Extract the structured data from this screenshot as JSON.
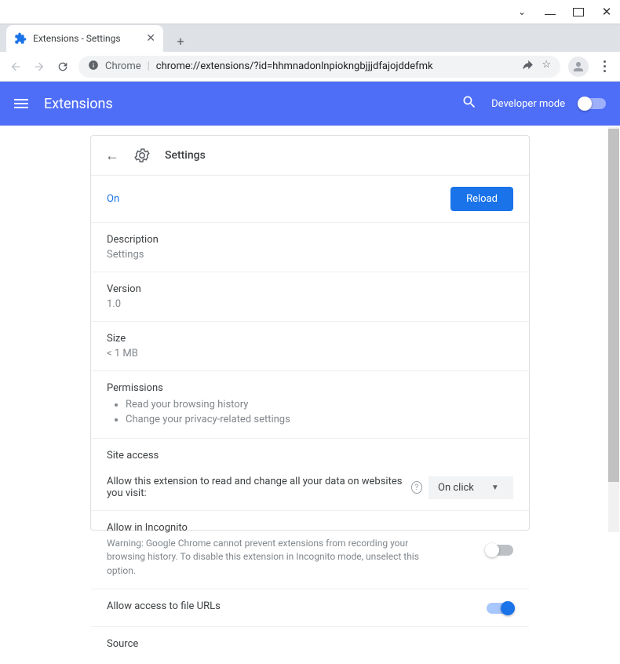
{
  "window": {
    "tab_title": "Extensions - Settings"
  },
  "addressbar": {
    "scheme_label": "Chrome",
    "url": "chrome://extensions/?id=hhmnadonlnpiokngbjjjdfajojddefmk"
  },
  "header": {
    "title": "Extensions",
    "dev_mode_label": "Developer mode",
    "dev_mode_on": false
  },
  "detail": {
    "title": "Settings",
    "on_label": "On",
    "reload_label": "Reload",
    "description_label": "Description",
    "description_value": "Settings",
    "version_label": "Version",
    "version_value": "1.0",
    "size_label": "Size",
    "size_value": "< 1 MB",
    "permissions_label": "Permissions",
    "permissions": [
      "Read your browsing history",
      "Change your privacy-related settings"
    ],
    "site_access_label": "Site access",
    "site_access_text": "Allow this extension to read and change all your data on websites you visit:",
    "site_access_value": "On click",
    "incognito_label": "Allow in Incognito",
    "incognito_warning": "Warning: Google Chrome cannot prevent extensions from recording your browsing history. To disable this extension in Incognito mode, unselect this option.",
    "incognito_on": false,
    "file_urls_label": "Allow access to file URLs",
    "file_urls_on": true,
    "source_label": "Source"
  }
}
